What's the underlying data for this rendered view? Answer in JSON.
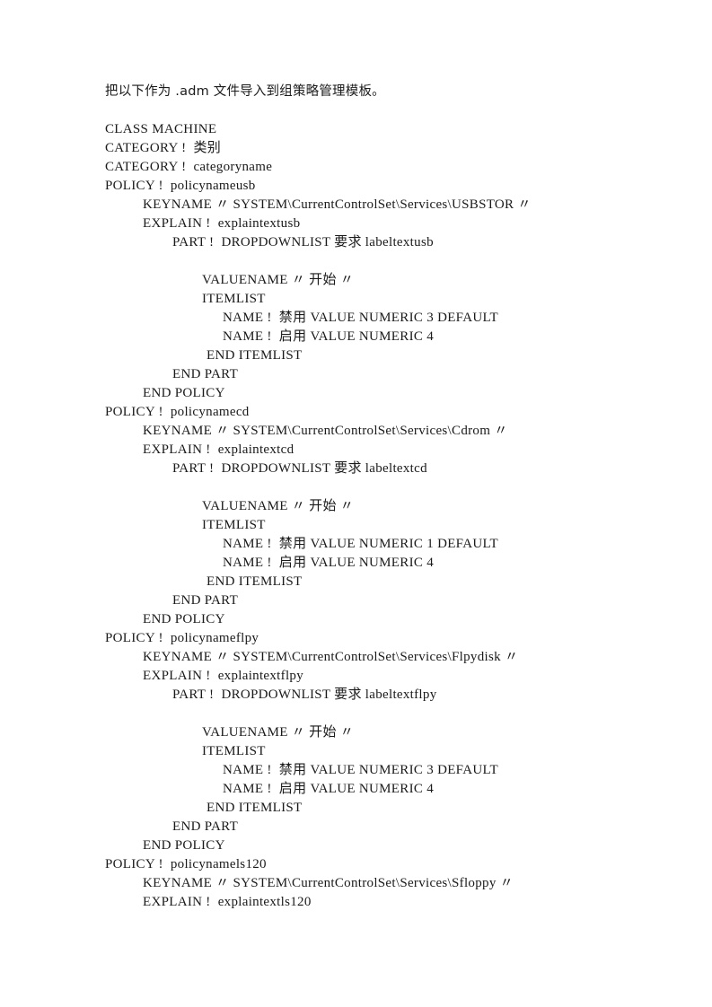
{
  "document": {
    "intro": "把以下作为 .adm 文件导入到组策略管理模板。",
    "lines": [
      {
        "indent": 0,
        "text": "CLASS MACHINE"
      },
      {
        "indent": 0,
        "text": "CATEGORY !  类别"
      },
      {
        "indent": 0,
        "text": "CATEGORY !  categoryname"
      },
      {
        "indent": 0,
        "text": "POLICY !  policynameusb"
      },
      {
        "indent": 1,
        "text": "KEYNAME 〃 SYSTEM\\CurrentControlSet\\Services\\USBSTOR 〃"
      },
      {
        "indent": 1,
        "text": "EXPLAIN !  explaintextusb"
      },
      {
        "indent": 3,
        "text": "PART !  DROPDOWNLIST 要求 labeltextusb"
      },
      {
        "indent": 0,
        "text": ""
      },
      {
        "indent": 4,
        "text": "VALUENAME 〃 开始 〃"
      },
      {
        "indent": 4,
        "text": "ITEMLIST"
      },
      {
        "indent": 5,
        "text": "NAME !  禁用 VALUE NUMERIC 3 DEFAULT"
      },
      {
        "indent": 5,
        "text": "NAME !  启用 VALUE NUMERIC 4"
      },
      {
        "indent": 6,
        "text": "END ITEMLIST"
      },
      {
        "indent": 7,
        "text": "END PART"
      },
      {
        "indent": 8,
        "text": "END POLICY"
      },
      {
        "indent": 0,
        "text": "POLICY !  policynamecd"
      },
      {
        "indent": 1,
        "text": "KEYNAME 〃 SYSTEM\\CurrentControlSet\\Services\\Cdrom 〃"
      },
      {
        "indent": 1,
        "text": "EXPLAIN !  explaintextcd"
      },
      {
        "indent": 3,
        "text": "PART !  DROPDOWNLIST 要求 labeltextcd"
      },
      {
        "indent": 0,
        "text": ""
      },
      {
        "indent": 4,
        "text": "VALUENAME 〃 开始 〃"
      },
      {
        "indent": 4,
        "text": "ITEMLIST"
      },
      {
        "indent": 5,
        "text": "NAME !  禁用 VALUE NUMERIC 1 DEFAULT"
      },
      {
        "indent": 5,
        "text": "NAME !  启用 VALUE NUMERIC 4"
      },
      {
        "indent": 6,
        "text": "END ITEMLIST"
      },
      {
        "indent": 7,
        "text": "END PART"
      },
      {
        "indent": 8,
        "text": "END POLICY"
      },
      {
        "indent": 0,
        "text": "POLICY !  policynameflpy"
      },
      {
        "indent": 1,
        "text": "KEYNAME 〃 SYSTEM\\CurrentControlSet\\Services\\Flpydisk 〃"
      },
      {
        "indent": 1,
        "text": "EXPLAIN !  explaintextflpy"
      },
      {
        "indent": 3,
        "text": "PART !  DROPDOWNLIST 要求 labeltextflpy"
      },
      {
        "indent": 0,
        "text": ""
      },
      {
        "indent": 4,
        "text": "VALUENAME 〃 开始 〃"
      },
      {
        "indent": 4,
        "text": "ITEMLIST"
      },
      {
        "indent": 5,
        "text": "NAME !  禁用 VALUE NUMERIC 3 DEFAULT"
      },
      {
        "indent": 5,
        "text": "NAME !  启用 VALUE NUMERIC 4"
      },
      {
        "indent": 6,
        "text": "END ITEMLIST"
      },
      {
        "indent": 7,
        "text": "END PART"
      },
      {
        "indent": 8,
        "text": "END POLICY"
      },
      {
        "indent": 0,
        "text": "POLICY !  policynamels120"
      },
      {
        "indent": 1,
        "text": "KEYNAME 〃 SYSTEM\\CurrentControlSet\\Services\\Sfloppy 〃"
      },
      {
        "indent": 1,
        "text": "EXPLAIN !  explaintextls120"
      }
    ]
  },
  "colors": {
    "page_background": "#ffffff",
    "text": "#1a1a1a"
  }
}
